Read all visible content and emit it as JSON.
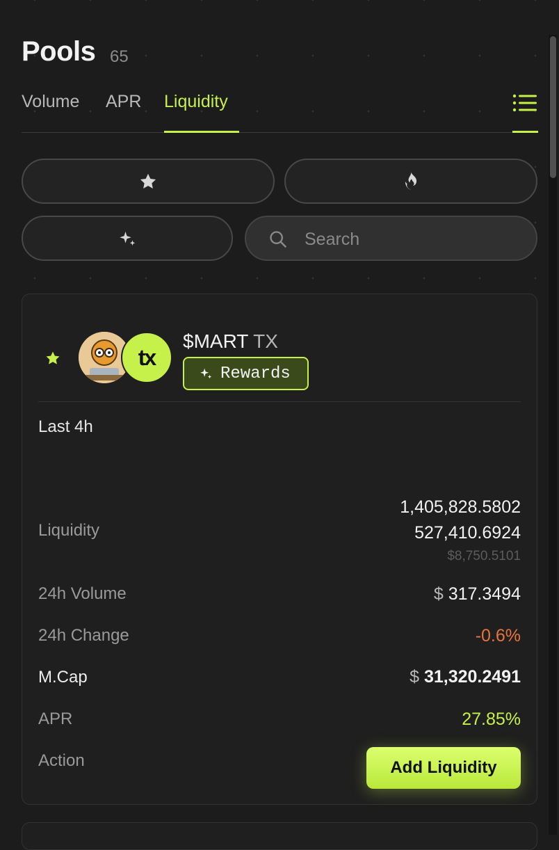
{
  "header": {
    "title": "Pools",
    "count": "65"
  },
  "tabs": [
    {
      "label": "Volume",
      "active": false
    },
    {
      "label": "APR",
      "active": false
    },
    {
      "label": "Liquidity",
      "active": true
    }
  ],
  "view_toggle": {
    "icon": "list-icon"
  },
  "filters": {
    "favorites_icon": "star-icon",
    "hot_icon": "fire-icon",
    "new_icon": "sparkles-icon",
    "search_placeholder": "Search"
  },
  "pool": {
    "base_symbol": "$MART",
    "quote_symbol": "TX",
    "badge": "Rewards",
    "period": "Last 4h",
    "rows": {
      "liquidity": {
        "label": "Liquidity",
        "amount_base": "1,405,828.5802",
        "amount_quote": "527,410.6924",
        "usd": "$8,750.5101"
      },
      "volume_24h": {
        "label": "24h Volume",
        "currency": "$",
        "value": "317.3494"
      },
      "change_24h": {
        "label": "24h Change",
        "value": "-0.6%"
      },
      "mcap": {
        "label": "M.Cap",
        "currency": "$",
        "value": "31,320.2491"
      },
      "apr": {
        "label": "APR",
        "value": "27.85%"
      },
      "action": {
        "label": "Action",
        "button": "Add Liquidity"
      }
    }
  },
  "colors": {
    "accent": "#c6f04a",
    "negative": "#e8743a",
    "background": "#1c1c1c"
  }
}
